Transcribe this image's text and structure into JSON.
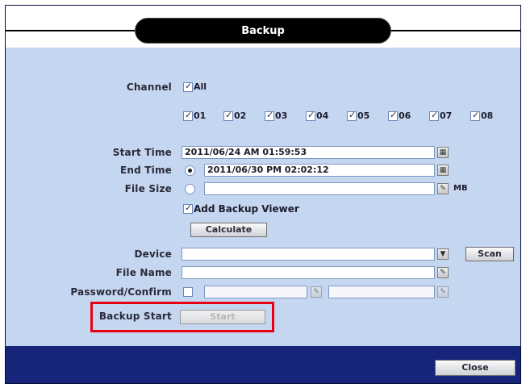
{
  "window": {
    "title": "Backup"
  },
  "channel": {
    "label": "Channel",
    "all_label": "All",
    "channels": [
      "01",
      "02",
      "03",
      "04",
      "05",
      "06",
      "07",
      "08"
    ]
  },
  "start_time": {
    "label": "Start Time",
    "value": "2011/06/24 AM 01:59:53"
  },
  "end_time": {
    "label": "End Time",
    "value": "2011/06/30 PM 02:02:12"
  },
  "file_size": {
    "label": "File Size",
    "value": "",
    "unit": "MB"
  },
  "add_viewer": {
    "label": "Add Backup Viewer"
  },
  "calculate_button": "Calculate",
  "device": {
    "label": "Device",
    "value": "",
    "scan_button": "Scan"
  },
  "file_name": {
    "label": "File Name",
    "value": ""
  },
  "password": {
    "label": "Password/Confirm"
  },
  "backup_start": {
    "label": "Backup Start",
    "button": "Start"
  },
  "close_button": "Close",
  "colors": {
    "frame": "#16247a",
    "panel": "#c5d6f1",
    "highlight": "#e60012"
  }
}
